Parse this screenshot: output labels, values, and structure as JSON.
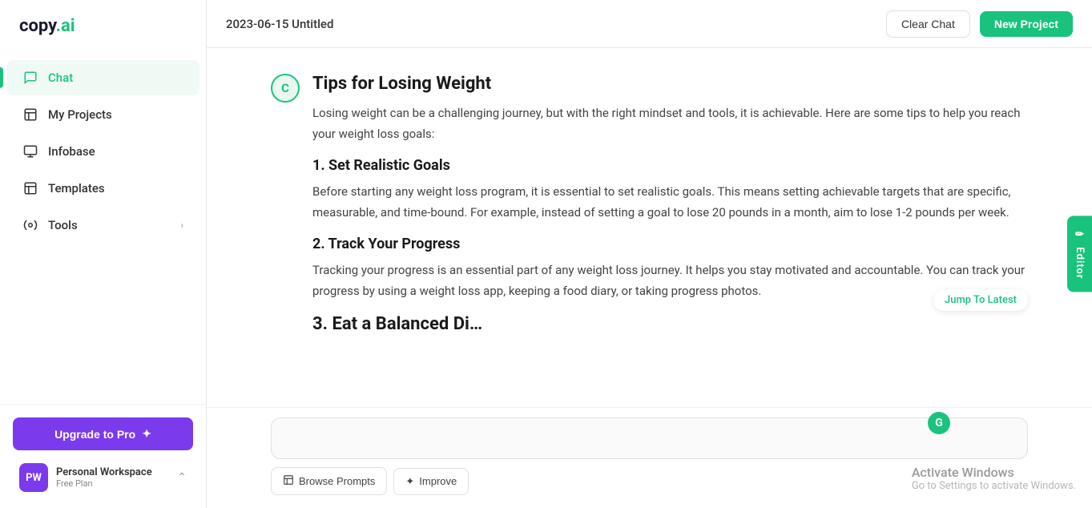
{
  "app": {
    "logo": "copy.ai",
    "logo_prefix": "copy",
    "logo_suffix": ".ai"
  },
  "sidebar": {
    "nav_items": [
      {
        "id": "chat",
        "label": "Chat",
        "icon": "chat",
        "active": true
      },
      {
        "id": "my-projects",
        "label": "My Projects",
        "icon": "projects",
        "active": false
      },
      {
        "id": "infobase",
        "label": "Infobase",
        "icon": "infobase",
        "active": false
      },
      {
        "id": "templates",
        "label": "Templates",
        "icon": "templates",
        "active": false
      },
      {
        "id": "tools",
        "label": "Tools",
        "icon": "tools",
        "active": false,
        "has_arrow": true
      }
    ],
    "upgrade_btn": "Upgrade to Pro",
    "workspace": {
      "initials": "PW",
      "name": "Personal Workspace",
      "plan": "Free Plan"
    }
  },
  "header": {
    "title": "2023-06-15 Untitled",
    "clear_chat_label": "Clear Chat",
    "new_project_label": "New Project"
  },
  "chat": {
    "user_avatar": "C",
    "message_title": "Tips for Losing Weight",
    "intro_text": "Losing weight can be a challenging journey, but with the right mindset and tools, it is achievable. Here are some tips to help you reach your weight loss goals:",
    "sections": [
      {
        "title": "1. Set Realistic Goals",
        "text": "Before starting any weight loss program, it is essential to set realistic goals. This means setting achievable targets that are specific, measurable, and time-bound. For example, instead of setting a goal to lose 20 pounds in a month, aim to lose 1-2 pounds per week."
      },
      {
        "title": "2. Track Your Progress",
        "text": "Tracking your progress is an essential part of any weight loss journey. It helps you stay motivated and accountable. You can track your progress by using a weight loss app, keeping a food diary, or taking progress photos."
      },
      {
        "title": "3. Eat a Balanced Di…",
        "text": ""
      }
    ],
    "jump_to_latest": "Jump To Latest",
    "g_icon_label": "G"
  },
  "toolbar": {
    "browse_prompts_label": "Browse Prompts",
    "improve_label": "Improve"
  },
  "editor_tab": {
    "label": "Editor"
  },
  "windows_watermark": {
    "title": "Activate Windows",
    "subtitle": "Go to Settings to activate Windows."
  }
}
